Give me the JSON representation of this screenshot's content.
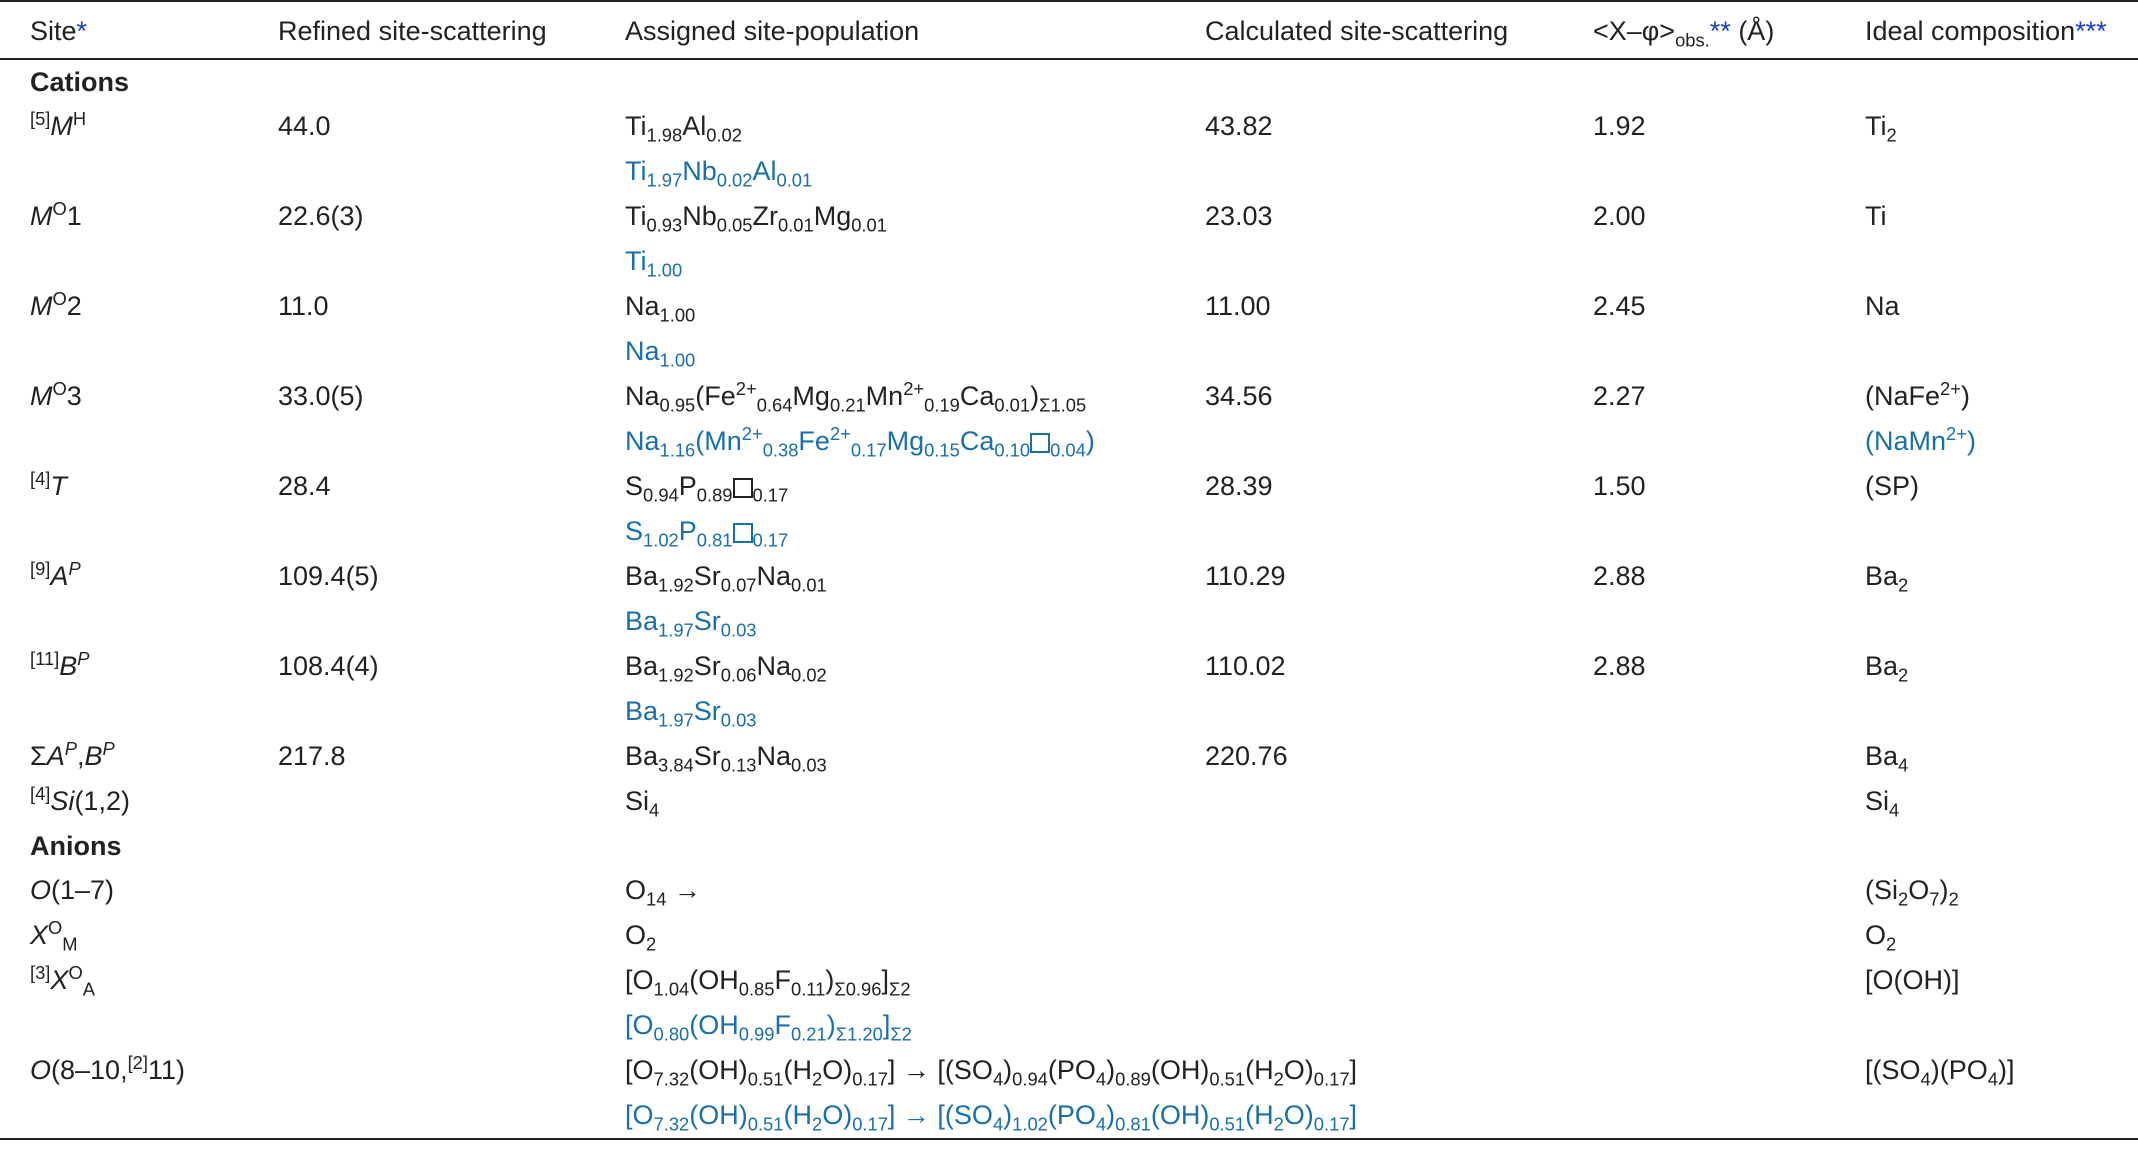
{
  "headers": {
    "site": "Site",
    "site_ast": "*",
    "refined": "Refined site-scattering",
    "assigned": "Assigned site-population",
    "calculated": "Calculated site-scattering",
    "dist_main": "<X–φ>",
    "dist_sub": "obs.",
    "dist_ast": "**",
    "dist_unit": "(Å)",
    "ideal": "Ideal composition",
    "ideal_ast": "***"
  },
  "sections": {
    "cations": "Cations",
    "anions": "Anions"
  },
  "rows": {
    "mh": {
      "site_pre": "[5]",
      "site_main": "M",
      "site_sup": "H",
      "refined": "44.0",
      "calc": "43.82",
      "dist": "1.92"
    },
    "mo1": {
      "site_main": "M",
      "site_sup": "O",
      "site_post": "1",
      "refined": "22.6(3)",
      "calc": "23.03",
      "dist": "2.00",
      "ideal": "Ti"
    },
    "mo2": {
      "site_main": "M",
      "site_sup": "O",
      "site_post": "2",
      "refined": "11.0",
      "calc": "11.00",
      "dist": "2.45",
      "ideal": "Na"
    },
    "mo3": {
      "site_main": "M",
      "site_sup": "O",
      "site_post": "3",
      "refined": "33.0(5)",
      "calc": "34.56",
      "dist": "2.27"
    },
    "t": {
      "site_pre": "[4]",
      "site_main": "T",
      "refined": "28.4",
      "calc": "28.39",
      "dist": "1.50",
      "ideal": "(SP)"
    },
    "ap": {
      "site_pre": "[9]",
      "site_main": "A",
      "site_sup": "P",
      "refined": "109.4(5)",
      "calc": "110.29",
      "dist": "2.88"
    },
    "bp": {
      "site_pre": "[11]",
      "site_main": "B",
      "site_sup": "P",
      "refined": "108.4(4)",
      "calc": "110.02",
      "dist": "2.88"
    },
    "sum": {
      "refined": "217.8",
      "calc": "220.76"
    },
    "si": {
      "site_pre": "[4]",
      "site_main": "Si",
      "site_post": "(1,2)"
    },
    "o17": {
      "site_main": "O",
      "site_post": "(1–7)",
      "assigned_arrow": "→"
    },
    "xom": {
      "site_main": "X",
      "site_sup": "O",
      "site_sub": "M"
    },
    "xoa": {
      "site_pre": "[3]",
      "site_main": "X",
      "site_sup": "O",
      "site_sub": "A",
      "ideal": "[O(OH)]"
    },
    "o811": {
      "site_main": "O",
      "site_post": "(8–10,",
      "site_pre2": "[2]",
      "site_post2": "11)"
    }
  }
}
